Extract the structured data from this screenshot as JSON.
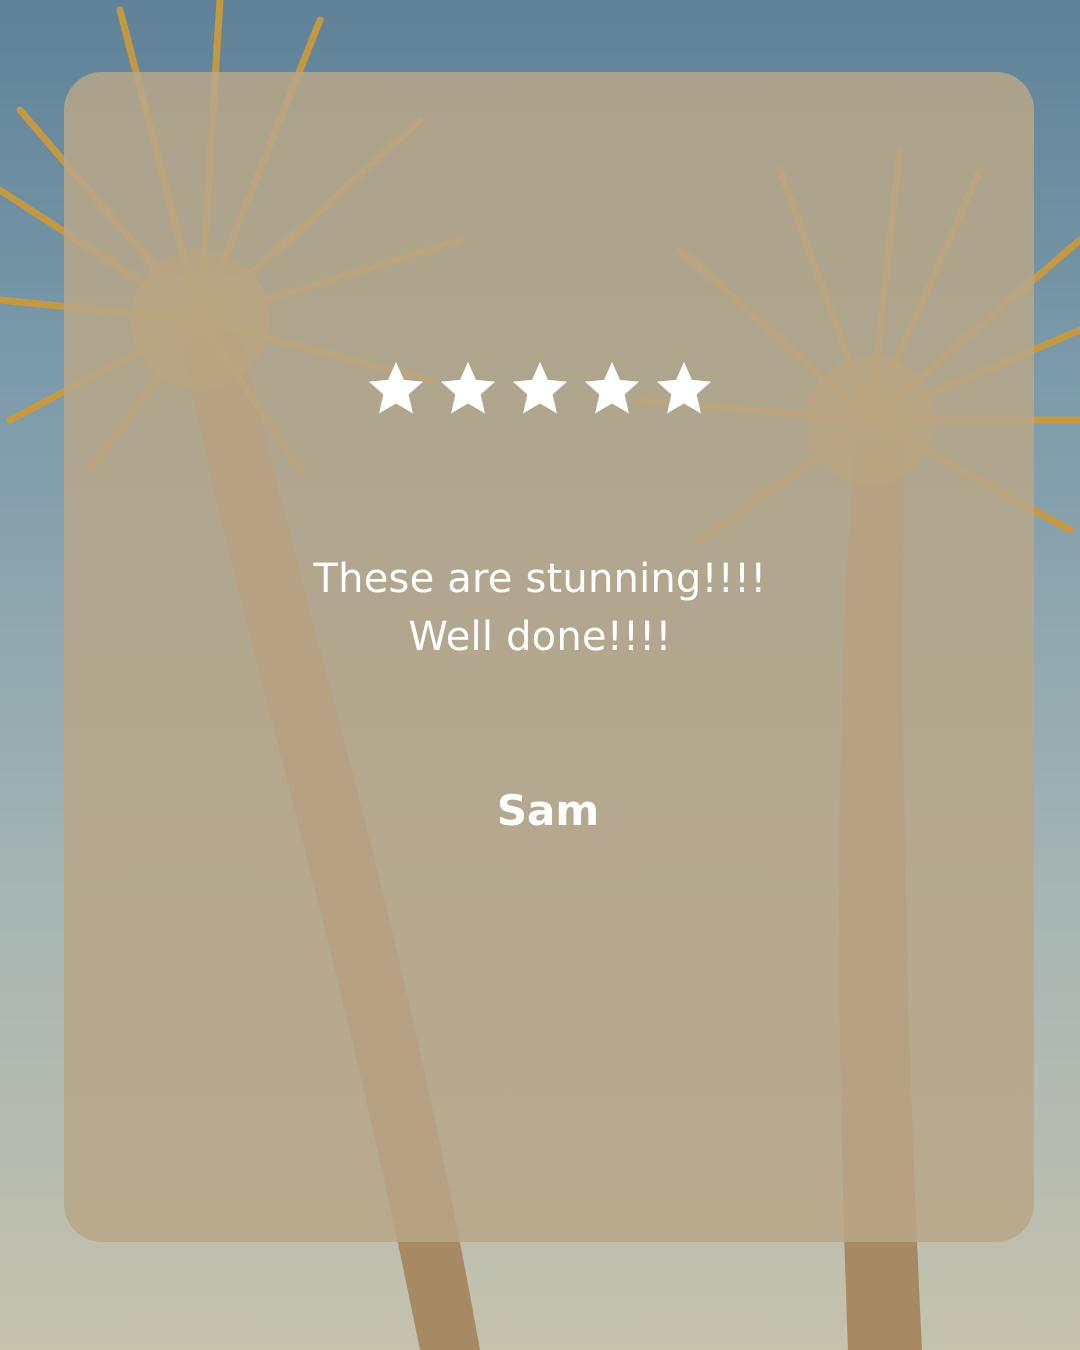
{
  "review": {
    "rating": 5,
    "rating_max": 5,
    "quote_lines": [
      "These are stunning!!!!",
      "Well done!!!!"
    ],
    "author": "Sam"
  },
  "colors": {
    "card": "#b8a688",
    "text": "#ffffff",
    "sky_top": "#5f8299",
    "sky_bottom": "#c5c2ae",
    "palm_frond": "#c99a3e",
    "palm_trunk": "#a78a63"
  },
  "icons": {
    "star": "star-icon",
    "palm": "palm-tree-icon"
  }
}
